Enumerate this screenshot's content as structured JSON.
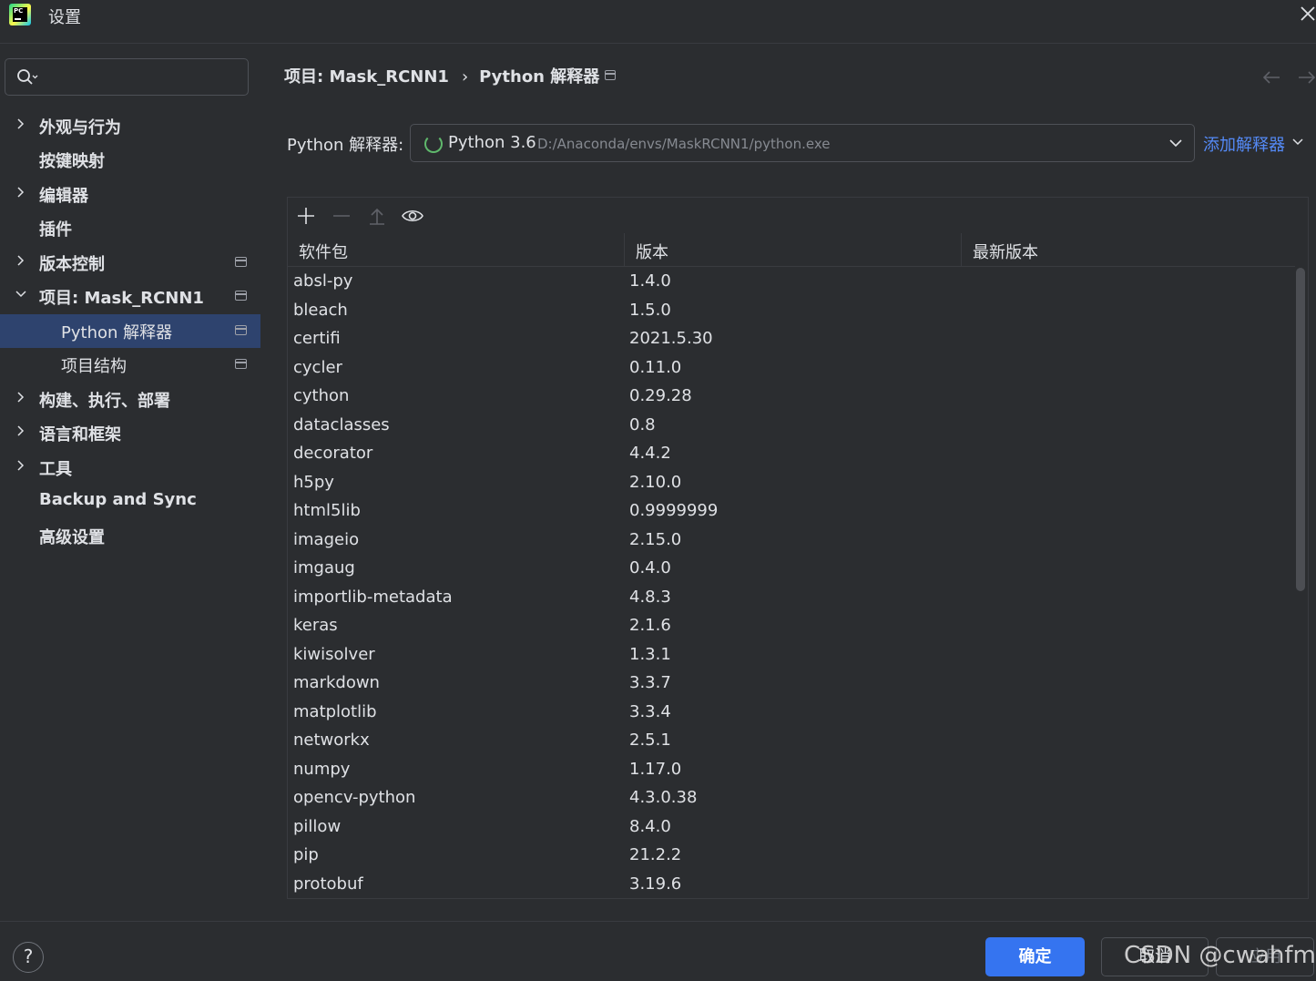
{
  "window": {
    "title": "设置"
  },
  "sidebar": {
    "search_placeholder": "",
    "items": [
      {
        "label": "外观与行为",
        "expandable": true
      },
      {
        "label": "按键映射",
        "expandable": false
      },
      {
        "label": "编辑器",
        "expandable": true
      },
      {
        "label": "插件",
        "expandable": false
      },
      {
        "label": "版本控制",
        "expandable": true
      },
      {
        "label": "项目: Mask_RCNN1",
        "expandable": true,
        "expanded": true
      },
      {
        "label": "Python 解释器",
        "selected": true
      },
      {
        "label": "项目结构"
      },
      {
        "label": "构建、执行、部署",
        "expandable": true
      },
      {
        "label": "语言和框架",
        "expandable": true
      },
      {
        "label": "工具",
        "expandable": true
      },
      {
        "label": "Backup and Sync",
        "expandable": false
      },
      {
        "label": "高级设置",
        "expandable": false
      }
    ]
  },
  "breadcrumb": {
    "parent": "项目: Mask_RCNN1",
    "current": "Python 解释器"
  },
  "interpreter": {
    "label": "Python 解释器:",
    "name": "Python 3.6",
    "path": "D:/Anaconda/envs/MaskRCNN1/python.exe",
    "add_label": "添加解释器"
  },
  "table": {
    "columns": [
      "软件包",
      "版本",
      "最新版本"
    ],
    "rows": [
      [
        "absl-py",
        "1.4.0",
        ""
      ],
      [
        "bleach",
        "1.5.0",
        ""
      ],
      [
        "certifi",
        "2021.5.30",
        ""
      ],
      [
        "cycler",
        "0.11.0",
        ""
      ],
      [
        "cython",
        "0.29.28",
        ""
      ],
      [
        "dataclasses",
        "0.8",
        ""
      ],
      [
        "decorator",
        "4.4.2",
        ""
      ],
      [
        "h5py",
        "2.10.0",
        ""
      ],
      [
        "html5lib",
        "0.9999999",
        ""
      ],
      [
        "imageio",
        "2.15.0",
        ""
      ],
      [
        "imgaug",
        "0.4.0",
        ""
      ],
      [
        "importlib-metadata",
        "4.8.3",
        ""
      ],
      [
        "keras",
        "2.1.6",
        ""
      ],
      [
        "kiwisolver",
        "1.3.1",
        ""
      ],
      [
        "markdown",
        "3.3.7",
        ""
      ],
      [
        "matplotlib",
        "3.3.4",
        ""
      ],
      [
        "networkx",
        "2.5.1",
        ""
      ],
      [
        "numpy",
        "1.17.0",
        ""
      ],
      [
        "opencv-python",
        "4.3.0.38",
        ""
      ],
      [
        "pillow",
        "8.4.0",
        ""
      ],
      [
        "pip",
        "21.2.2",
        ""
      ],
      [
        "protobuf",
        "3.19.6",
        ""
      ]
    ]
  },
  "footer": {
    "help": "?",
    "ok": "确定",
    "cancel": "取消",
    "apply": "应用"
  },
  "watermark": "CSDN @cwahfma",
  "colors": {
    "background": "#2b2d30",
    "selection": "#2e436e",
    "accent": "#3574f0",
    "link": "#548af7"
  }
}
